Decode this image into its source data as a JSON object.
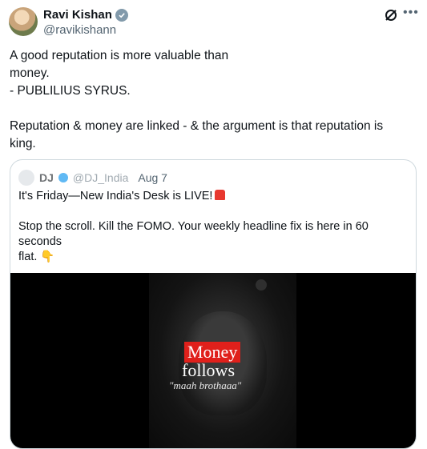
{
  "author": {
    "name": "Ravi Kishan",
    "handle": "@ravikishann"
  },
  "tweet": {
    "text": "A good reputation is more valuable than\nmoney.\n- PUBLILIUS SYRUS.\n\nReputation & money are linked - & the argument is that reputation is\nking."
  },
  "quoted": {
    "name": "DJ",
    "handle": "@DJ_India",
    "date": "Aug 7",
    "line1": "It's Friday—New India's Desk is LIVE!",
    "line2": "Stop the scroll. Kill the FOMO. Your weekly headline fix is here in 60 seconds\nflat.",
    "ellipsis": "...",
    "video": {
      "caption_top": "Money",
      "caption_mid": "follows",
      "caption_sub": "\"maah brothaaa\""
    }
  },
  "icons": {
    "verified": "verified-badge-icon",
    "grok": "grok-icon",
    "more": "more-icon"
  },
  "colors": {
    "caption_red": "#e0201b",
    "muted": "#536471"
  }
}
